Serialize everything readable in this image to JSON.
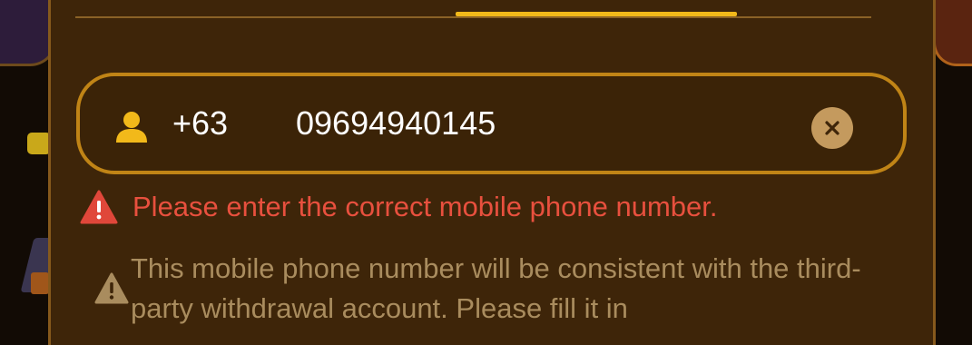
{
  "colors": {
    "panel_bg": "#3e2509",
    "accent_gold": "#f2b91a",
    "field_border": "#c08416",
    "error_red": "#e8503e",
    "notice_tan": "#a98c5e"
  },
  "phone_field": {
    "icon": "user-icon",
    "country_code": "+63",
    "value": "09694940145",
    "clear_icon": "close-icon"
  },
  "error": {
    "icon": "warning-triangle-icon",
    "message": "Please enter the correct mobile phone number."
  },
  "notice": {
    "icon": "warning-triangle-icon",
    "text": "This mobile phone number will be consistent with the third-party withdrawal account. Please fill it in"
  }
}
